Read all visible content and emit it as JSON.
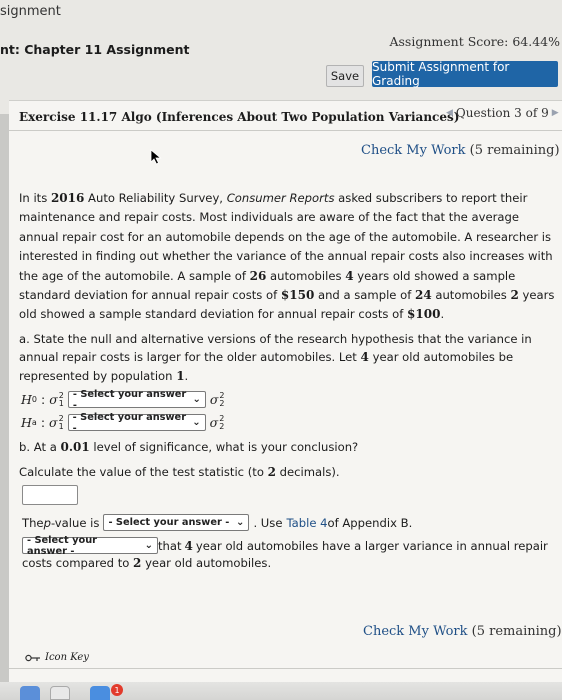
{
  "header": {
    "title": "signment",
    "chapter": "nt: Chapter 11 Assignment",
    "score": "Assignment Score: 64.44%",
    "save_label": "Save",
    "submit_label": "Submit Assignment for Grading"
  },
  "exercise": {
    "title": "Exercise 11.17 Algo (Inferences About Two Population Variances)",
    "question_nav": "Question 3 of 9",
    "check_link": "Check My Work",
    "check_remaining": "(5 remaining)"
  },
  "problem": {
    "p1": "In its ",
    "year": "2016",
    "p2": " Auto Reliability Survey, ",
    "source": "Consumer Reports",
    "p3": " asked subscribers to report their maintenance and repair costs. Most individuals are aware of the fact that the average annual repair cost for an automobile depends on the age of the automobile. A researcher is interested in finding out whether the variance of the annual repair costs also increases with the age of the automobile. A sample of ",
    "n1": "26",
    "p4": " automobiles ",
    "age1": "4",
    "p5": " years old showed a sample standard deviation for annual repair costs of ",
    "s1": "$150",
    "p6": " and a sample of ",
    "n2": "24",
    "p7": " automobiles ",
    "age2": "2",
    "p8": " years old showed a sample standard deviation for annual repair costs of ",
    "s2": "$100",
    "p9": "."
  },
  "part_a": {
    "t1": "a. State the null and alternative versions of the research hypothesis that the variance in annual repair costs is larger for the older automobiles. Let ",
    "age": "4",
    "t2": " year old automobiles be represented by population ",
    "pop": "1",
    "t3": ".",
    "h0_label": "H",
    "h0_sub": "0",
    "ha_label": "H",
    "ha_sub": "a",
    "select_placeholder": "- Select your answer -"
  },
  "part_b": {
    "t1": "b. At a ",
    "alpha": "0.01",
    "t2": " level of significance, what is your conclusion?",
    "calc1": "Calculate the value of the test statistic (to ",
    "calc_n": "2",
    "calc2": " decimals).",
    "pvalue_pre": "The ",
    "pvalue_p": "p",
    "pvalue_post": "-value is",
    "use_text": ". Use ",
    "table_link": "Table 4",
    "appendix": " of Appendix B.",
    "concl1": " that ",
    "concl_age1": "4",
    "concl2": " year old automobiles have a larger variance in annual repair",
    "concl3": "costs compared to ",
    "concl_age2": "2",
    "concl4": " year old automobiles."
  },
  "footer": {
    "icon_key": "Icon Key",
    "badge": "1"
  }
}
